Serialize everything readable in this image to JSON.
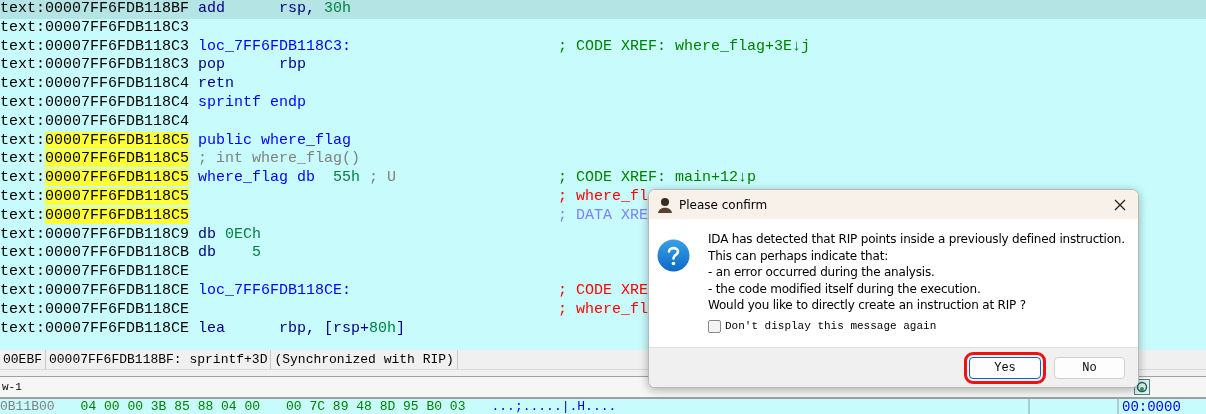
{
  "listing": {
    "rows": [
      {
        "prefix": "text:",
        "address": "00007FF6FDB118BF",
        "current": true,
        "highlighted": false,
        "code": [
          {
            "text": "add      ",
            "kind": "mnemonic"
          },
          {
            "text": "rsp, ",
            "kind": "operand"
          },
          {
            "text": "30h",
            "kind": "number"
          }
        ]
      },
      {
        "prefix": "text:",
        "address": "00007FF6FDB118C3",
        "current": false,
        "highlighted": false,
        "code": []
      },
      {
        "prefix": "text:",
        "address": "00007FF6FDB118C3",
        "current": false,
        "highlighted": false,
        "code": [
          {
            "text": "loc_7FF6FDB118C3:",
            "kind": "label"
          }
        ],
        "comment": {
          "text": "; CODE XREF: where_flag+3E↓j",
          "kind": "code-xref"
        }
      },
      {
        "prefix": "text:",
        "address": "00007FF6FDB118C3",
        "current": false,
        "highlighted": false,
        "code": [
          {
            "text": "pop      ",
            "kind": "mnemonic"
          },
          {
            "text": "rbp",
            "kind": "operand"
          }
        ]
      },
      {
        "prefix": "text:",
        "address": "00007FF6FDB118C4",
        "current": false,
        "highlighted": false,
        "code": [
          {
            "text": "retn",
            "kind": "mnemonic"
          }
        ]
      },
      {
        "prefix": "text:",
        "address": "00007FF6FDB118C4",
        "current": false,
        "highlighted": false,
        "code": [
          {
            "text": "sprintf endp",
            "kind": "label"
          }
        ]
      },
      {
        "prefix": "text:",
        "address": "00007FF6FDB118C4",
        "current": false,
        "highlighted": false,
        "code": []
      },
      {
        "prefix": "text:",
        "address": "00007FF6FDB118C5",
        "current": false,
        "highlighted": true,
        "code": [
          {
            "text": "public where_flag",
            "kind": "label"
          }
        ]
      },
      {
        "prefix": "text:",
        "address": "00007FF6FDB118C5",
        "current": false,
        "highlighted": true,
        "code": [
          {
            "text": "; int where_flag()",
            "kind": "note"
          }
        ]
      },
      {
        "prefix": "text:",
        "address": "00007FF6FDB118C5",
        "current": false,
        "highlighted": true,
        "code": [
          {
            "text": "where_flag db  ",
            "kind": "label"
          },
          {
            "text": "55h",
            "kind": "number"
          },
          {
            "text": " ; U",
            "kind": "note"
          }
        ],
        "comment": {
          "text": "; CODE XREF: main+12↓p",
          "kind": "code-xref"
        }
      },
      {
        "prefix": "text:",
        "address": "00007FF6FDB118C5",
        "current": false,
        "highlighted": true,
        "code": [],
        "comment": {
          "text": "; where_fl",
          "kind": "red-xref"
        }
      },
      {
        "prefix": "text:",
        "address": "00007FF6FDB118C5",
        "current": false,
        "highlighted": true,
        "code": [],
        "comment": {
          "text": "; DATA XRE",
          "kind": "data-xref"
        }
      },
      {
        "prefix": "text:",
        "address": "00007FF6FDB118C9",
        "current": false,
        "highlighted": false,
        "code": [
          {
            "text": "db ",
            "kind": "mnemonic"
          },
          {
            "text": "0ECh",
            "kind": "number"
          }
        ]
      },
      {
        "prefix": "text:",
        "address": "00007FF6FDB118CB",
        "current": false,
        "highlighted": false,
        "code": [
          {
            "text": "db    ",
            "kind": "mnemonic"
          },
          {
            "text": "5",
            "kind": "number"
          }
        ]
      },
      {
        "prefix": "text:",
        "address": "00007FF6FDB118CE",
        "current": false,
        "highlighted": false,
        "code": []
      },
      {
        "prefix": "text:",
        "address": "00007FF6FDB118CE",
        "current": false,
        "highlighted": false,
        "code": [
          {
            "text": "loc_7FF6FDB118CE:",
            "kind": "label"
          }
        ],
        "comment": {
          "text": "; CODE XRE",
          "kind": "red-xref"
        }
      },
      {
        "prefix": "text:",
        "address": "00007FF6FDB118CE",
        "current": false,
        "highlighted": false,
        "code": [],
        "comment": {
          "text": "; where_fl",
          "kind": "red-xref"
        }
      },
      {
        "prefix": "text:",
        "address": "00007FF6FDB118CE",
        "current": false,
        "highlighted": false,
        "code": [
          {
            "text": "lea      ",
            "kind": "mnemonic"
          },
          {
            "text": "rbp, [rsp+",
            "kind": "operand"
          },
          {
            "text": "80h",
            "kind": "number"
          },
          {
            "text": "]",
            "kind": "operand"
          }
        ]
      }
    ]
  },
  "status_bar": [
    "00EBF",
    "00007FF6FDB118BF: sprintf+3D",
    "(Synchronized with RIP)"
  ],
  "tab": {
    "label": "w-1"
  },
  "hex_row": {
    "address": "0B11B00",
    "bytes_1": "04 00 00 3B 85 88 04 00",
    "bytes_2": "00 7C 89 48 8D 95 B0 03",
    "ascii": "...;.....|.H...."
  },
  "side_readout": "00:0000",
  "dialog": {
    "title": "Please confirm",
    "lines": [
      "IDA has detected that RIP points inside a previously defined instruction.",
      "This can perhaps indicate that:",
      "- an error occurred during the analysis.",
      "- the code modified itself during the execution.",
      "Would you like to directly create an instruction at RIP ?"
    ],
    "checkbox": {
      "label": "Don't display this message again",
      "checked": false
    },
    "buttons": [
      {
        "label": "Yes",
        "selected": true
      },
      {
        "label": "No",
        "selected": false
      }
    ]
  }
}
